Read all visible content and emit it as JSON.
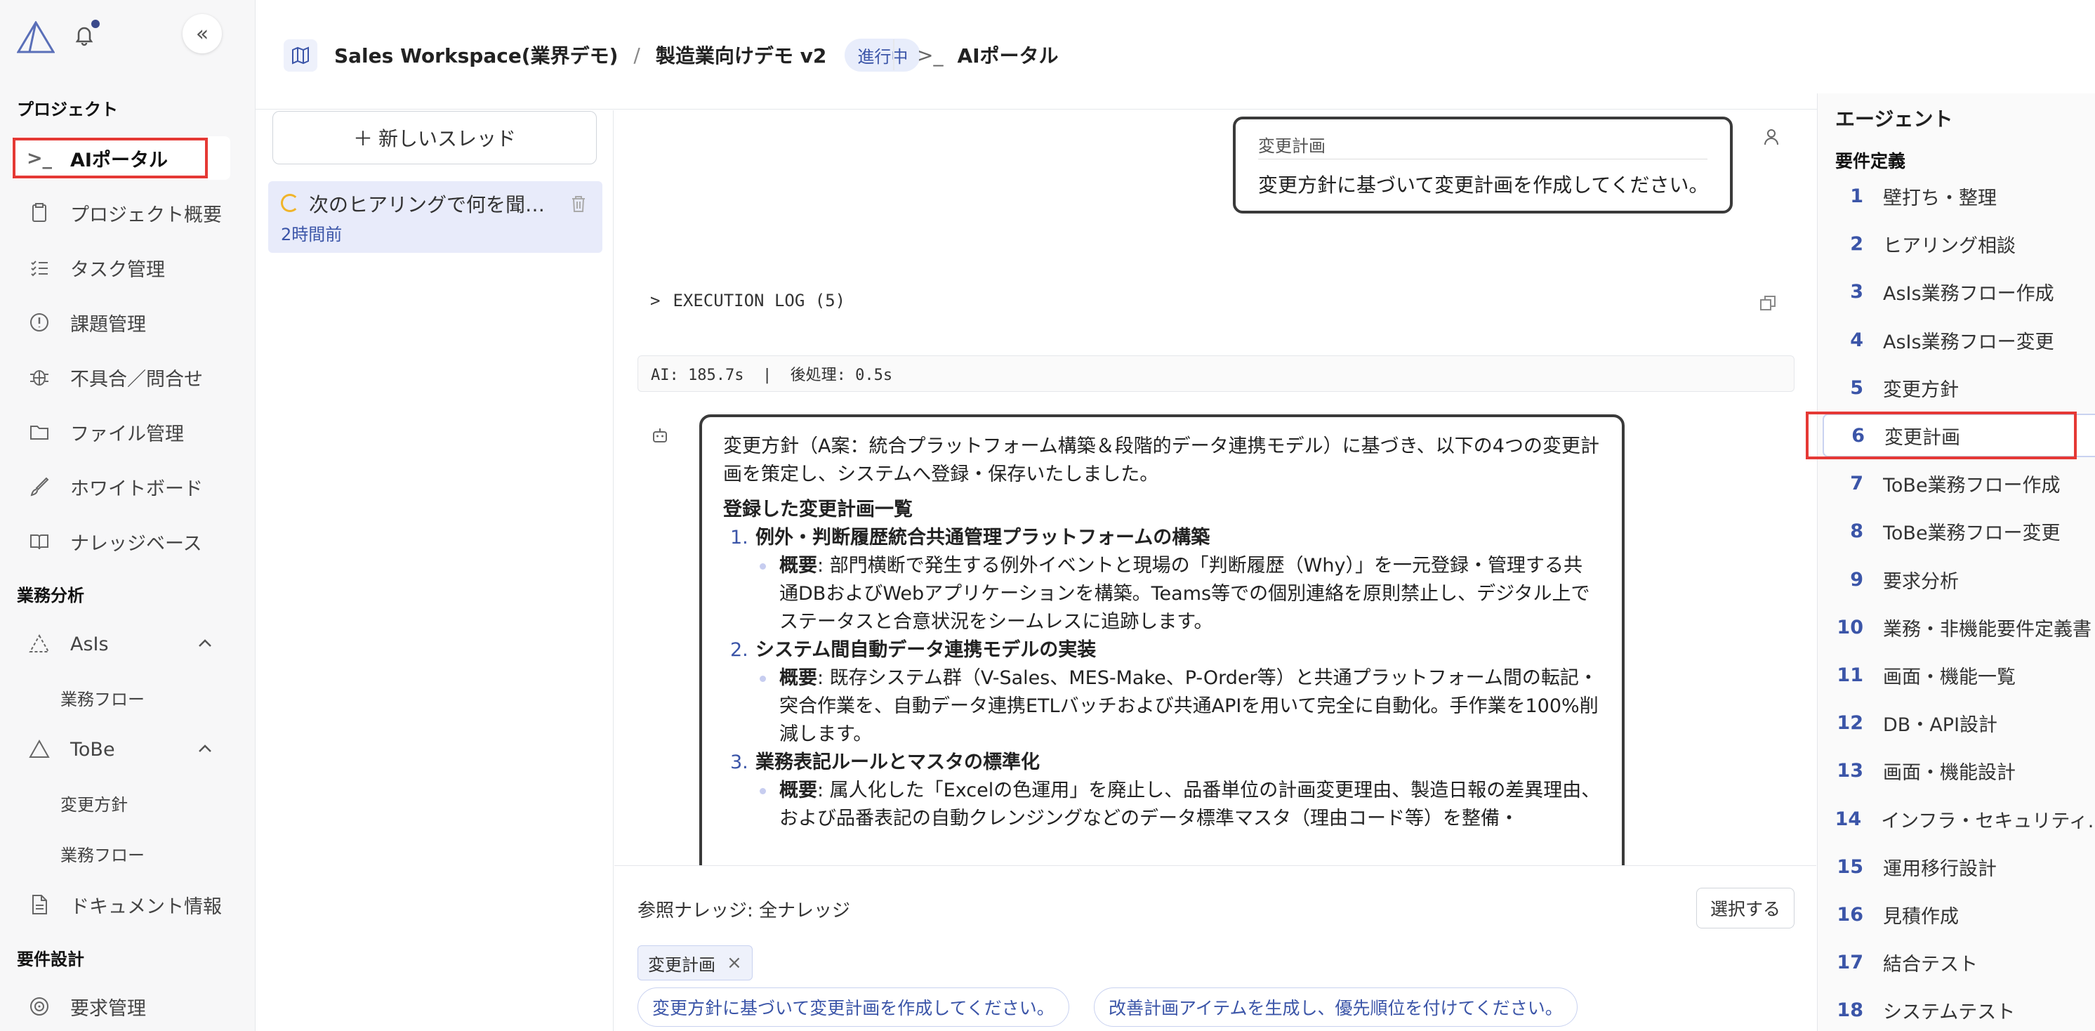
{
  "sidebar": {
    "sections": {
      "project": "プロジェクト",
      "business_analysis": "業務分析",
      "requirements_design": "要件設計"
    },
    "items": {
      "ai_portal": "AIポータル",
      "project_overview": "プロジェクト概要",
      "task_management": "タスク管理",
      "issue_management": "課題管理",
      "defects": "不具合／問合せ",
      "file_management": "ファイル管理",
      "whiteboard": "ホワイトボード",
      "knowledge_base": "ナレッジベース",
      "asis": "AsIs",
      "asis_flow": "業務フロー",
      "tobe": "ToBe",
      "tobe_policy": "変更方針",
      "tobe_flow": "業務フロー",
      "document_info": "ドキュメント情報",
      "requirements_management": "要求管理"
    }
  },
  "header": {
    "workspace": "Sales Workspace(業界デモ)",
    "separator": "/",
    "project": "製造業向けデモ v2",
    "status_badge": "進行中",
    "portal_title": "AIポータル"
  },
  "threads": {
    "new_thread_label": "新しいスレッド",
    "items": [
      {
        "title": "次のヒアリングで何を聞くべきか",
        "time": "2時間前"
      }
    ]
  },
  "chat": {
    "user_message": {
      "label": "変更計画",
      "text": "変更方針に基づいて変更計画を作成してください。"
    },
    "execution_log": "EXECUTION LOG (5)",
    "timing": "AI: 185.7s  |  後処理: 0.5s",
    "ai_message": {
      "intro": "変更方針（A案：統合プラットフォーム構築＆段階的データ連携モデル）に基づき、以下の4つの変更計画を策定し、システムへ登録・保存いたしました。",
      "heading": "登録した変更計画一覧",
      "summary_label": "概要",
      "plans": [
        {
          "num": "1.",
          "title": "例外・判断履歴統合共通管理プラットフォームの構築",
          "summary": ": 部門横断で発生する例外イベントと現場の「判断履歴（Why）」を一元登録・管理する共通DBおよびWebアプリケーションを構築。Teams等での個別連絡を原則禁止し、デジタル上でステータスと合意状況をシームレスに追跡します。"
        },
        {
          "num": "2.",
          "title": "システム間自動データ連携モデルの実装",
          "summary": ": 既存システム群（V-Sales、MES-Make、P-Order等）と共通プラットフォーム間の転記・突合作業を、自動データ連携ETLバッチおよび共通APIを用いて完全に自動化。手作業を100%削減します。"
        },
        {
          "num": "3.",
          "title": "業務表記ルールとマスタの標準化",
          "summary": ": 属人化した「Excelの色運用」を廃止し、品番単位の計画変更理由、製造日報の差異理由、および品番表記の自動クレンジングなどのデータ標準マスタ（理由コード等）を整備・"
        }
      ]
    }
  },
  "composer": {
    "reference_label": "参照ナレッジ: 全ナレッジ",
    "select_button": "選択する",
    "tag": "変更計画",
    "suggestions": [
      "変更方針に基づいて変更計画を作成してください。",
      "改善計画アイテムを生成し、優先順位を付けてください。"
    ]
  },
  "agents": {
    "title": "エージェント",
    "section": "要件定義",
    "items": [
      {
        "num": "1",
        "label": "壁打ち・整理"
      },
      {
        "num": "2",
        "label": "ヒアリング相談"
      },
      {
        "num": "3",
        "label": "AsIs業務フロー作成"
      },
      {
        "num": "4",
        "label": "AsIs業務フロー変更"
      },
      {
        "num": "5",
        "label": "変更方針"
      },
      {
        "num": "6",
        "label": "変更計画"
      },
      {
        "num": "7",
        "label": "ToBe業務フロー作成"
      },
      {
        "num": "8",
        "label": "ToBe業務フロー変更"
      },
      {
        "num": "9",
        "label": "要求分析"
      },
      {
        "num": "10",
        "label": "業務・非機能要件定義書"
      },
      {
        "num": "11",
        "label": "画面・機能一覧"
      },
      {
        "num": "12",
        "label": "DB・API設計"
      },
      {
        "num": "13",
        "label": "画面・機能設計"
      },
      {
        "num": "14",
        "label": "インフラ・セキュリティ..."
      },
      {
        "num": "15",
        "label": "運用移行設計"
      },
      {
        "num": "16",
        "label": "見積作成"
      },
      {
        "num": "17",
        "label": "結合テスト"
      },
      {
        "num": "18",
        "label": "システムテスト"
      }
    ]
  },
  "colors": {
    "accent": "#3b55a8",
    "highlight": "#e53935",
    "active_thread_bg": "#e8ebfa"
  }
}
